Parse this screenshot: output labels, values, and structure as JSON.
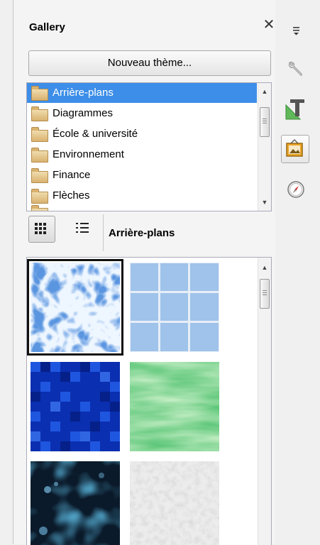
{
  "sidebar": {
    "title": "Gallery",
    "new_theme_label": "Nouveau thème...",
    "themes": [
      "Arrière-plans",
      "Diagrammes",
      "École & université",
      "Environnement",
      "Finance",
      "Flèches"
    ],
    "selected_theme_index": 0,
    "current_theme": "Arrière-plans",
    "view_mode": "icon",
    "accent": "#3d8ee8"
  },
  "tabbar": {
    "icons": [
      "sidebar-menu-icon",
      "properties-wrench-icon",
      "styles-icon",
      "gallery-icon",
      "navigator-compass-icon"
    ],
    "active": "gallery-icon"
  },
  "gallery_items": [
    {
      "name": "water-texture",
      "selected": true
    },
    {
      "name": "blue-tiles-texture",
      "selected": false
    },
    {
      "name": "blue-mosaic-texture",
      "selected": false
    },
    {
      "name": "green-marble-texture",
      "selected": false
    },
    {
      "name": "dark-blue-bubbles-texture",
      "selected": false
    },
    {
      "name": "white-stucco-texture",
      "selected": false
    }
  ]
}
